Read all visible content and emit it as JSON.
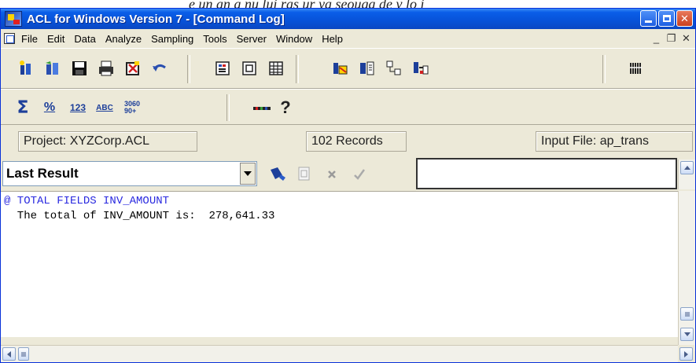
{
  "above_text": "e un an a nu lui  ras ur ya seouga de v lo  i",
  "window": {
    "title": "ACL for Windows Version 7 - [Command Log]"
  },
  "menu": {
    "items": [
      {
        "label": "File"
      },
      {
        "label": "Edit"
      },
      {
        "label": "Data"
      },
      {
        "label": "Analyze"
      },
      {
        "label": "Sampling"
      },
      {
        "label": "Tools"
      },
      {
        "label": "Server"
      },
      {
        "label": "Window"
      },
      {
        "label": "Help"
      }
    ]
  },
  "status": {
    "project": "Project: XYZCorp.ACL",
    "records": "102 Records",
    "input_file": "Input File: ap_trans"
  },
  "results": {
    "selected": "Last Result",
    "command_value": ""
  },
  "log": {
    "command": "@ TOTAL FIELDS INV_AMOUNT",
    "output": "  The total of INV_AMOUNT is:  278,641.33"
  },
  "toolbar2": {
    "sigma_label": "Σ",
    "stat_label": "%",
    "count_label": "123",
    "abc_label": "ABC",
    "age_label": "3060\n90+"
  },
  "colors": {
    "title_bar": "#0a5ee8",
    "command_text": "#2a2ae0",
    "chrome": "#ece9d8"
  }
}
